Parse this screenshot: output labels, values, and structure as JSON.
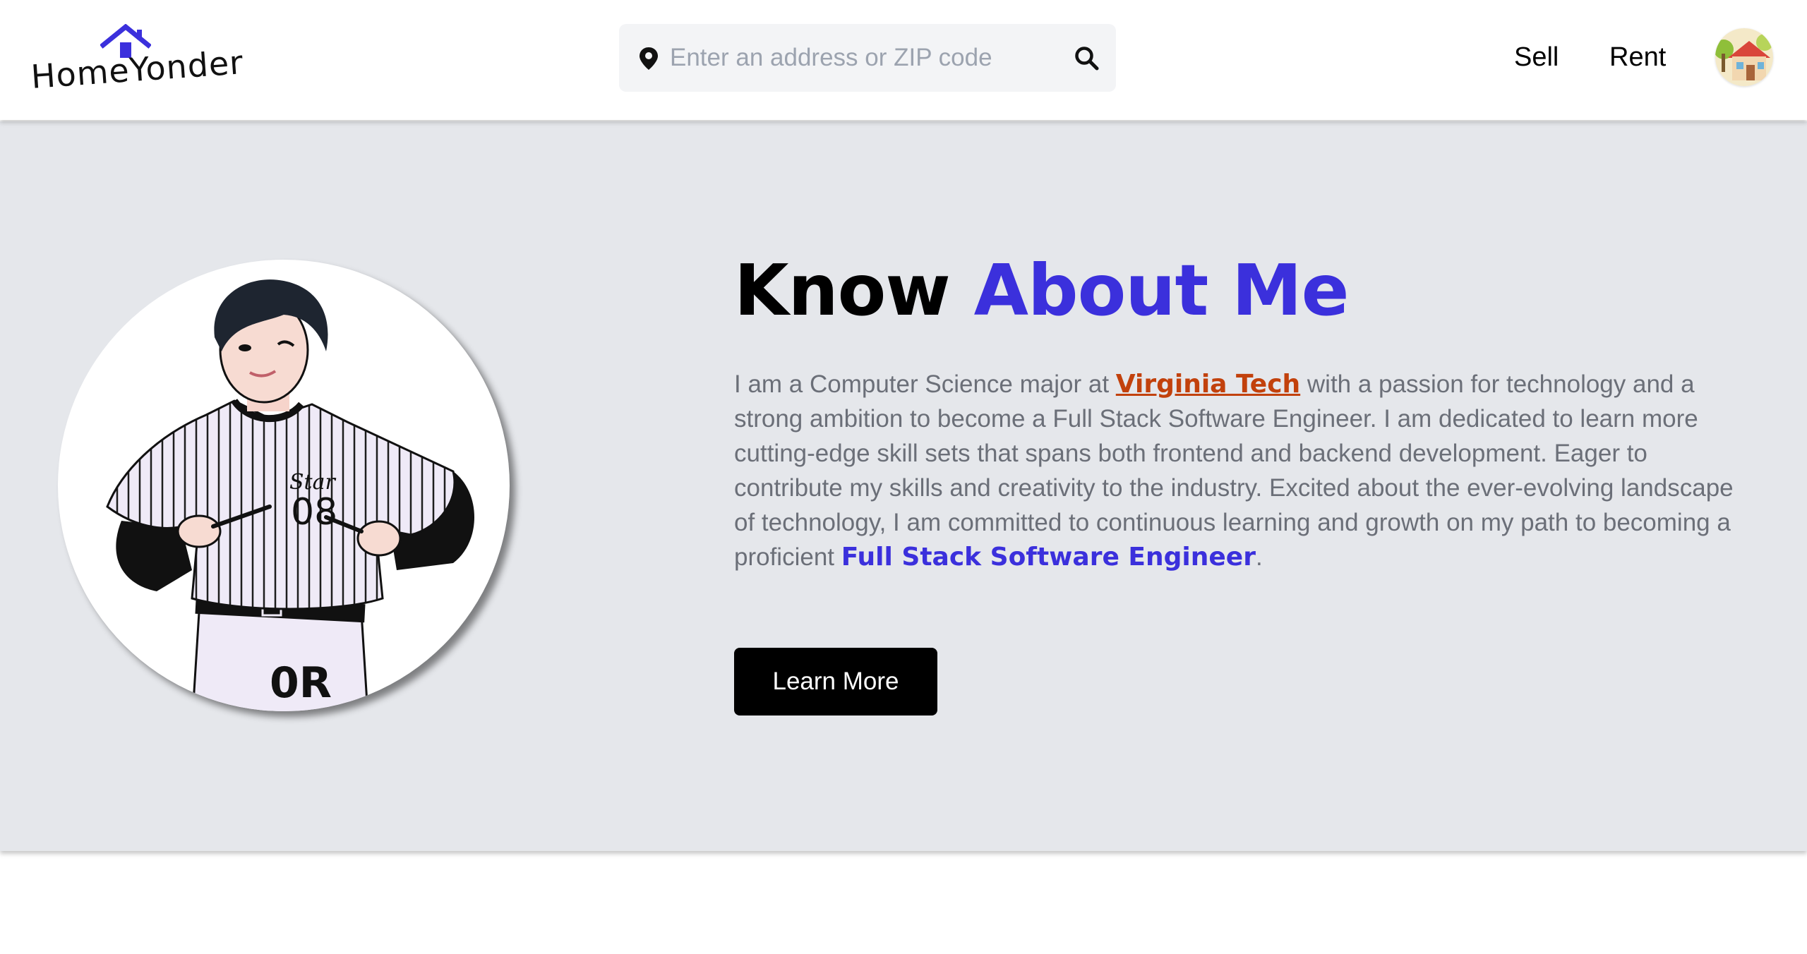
{
  "header": {
    "logo_text": "HomeYonder",
    "search": {
      "placeholder": "Enter an address or ZIP code",
      "value": ""
    },
    "nav": {
      "sell_label": "Sell",
      "rent_label": "Rent"
    }
  },
  "about": {
    "title_part1": "Know ",
    "title_part2": "About Me",
    "text_before_link": "I am a Computer Science major at ",
    "link_text": "Virginia Tech",
    "text_after_link": " with a passion for technology and a strong ambition to become a Full Stack Software Engineer. I am dedicated to learn more cutting-edge skill sets that spans both frontend and backend development. Eager to contribute my skills and creativity to the industry. Excited about the ever-evolving landscape of technology, I am committed to continuous learning and growth on my path to becoming a proficient ",
    "highlight_text": "Full Stack Software Engineer",
    "text_end": ".",
    "button_label": "Learn More"
  },
  "colors": {
    "accent": "#3b30dc",
    "link": "#c2410c",
    "section_bg": "#e5e7eb",
    "body_text": "#6b6f78"
  },
  "icons": {
    "logo": "house-roof-icon",
    "search_left": "map-pin-icon",
    "search_right": "search-icon",
    "avatar": "house-avatar-icon"
  }
}
